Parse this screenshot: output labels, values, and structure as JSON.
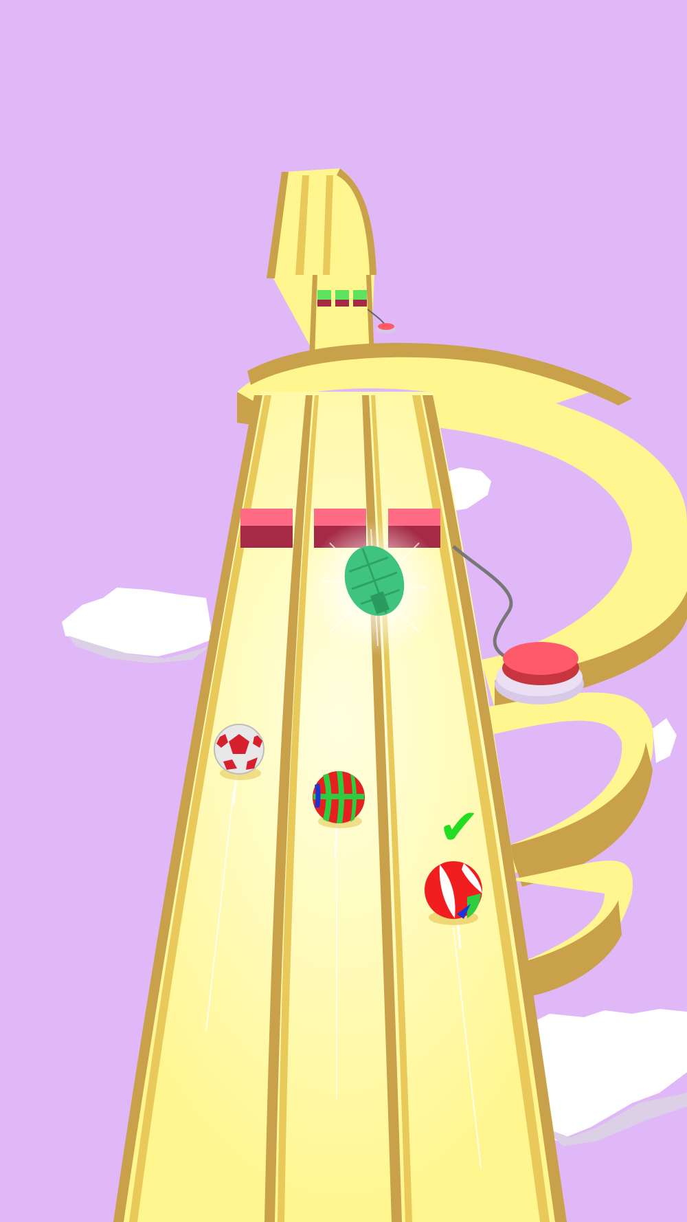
{
  "game": {
    "colors": {
      "sky": "#e0b8f8",
      "track_top": "#fff68f",
      "track_side": "#c9a14a",
      "track_rail": "#e8c95a",
      "barrier_top": "#ff6b85",
      "barrier_side": "#a52a45",
      "button_red": "#ff5a6a",
      "button_base": "#d9c9e8",
      "cloud": "#ffffff",
      "check_green": "#22dd22",
      "grenade_green": "#3fc47f"
    },
    "lanes": 3,
    "barrier_blocks": 3,
    "distant_barrier_blocks": 3,
    "player_lane": 3,
    "player_ball": "beach-ball",
    "opponent_balls": [
      "soccer-ball",
      "striped-ball"
    ],
    "powerup": "grenade",
    "checkmark_glyph": "✔",
    "status": "selected"
  }
}
